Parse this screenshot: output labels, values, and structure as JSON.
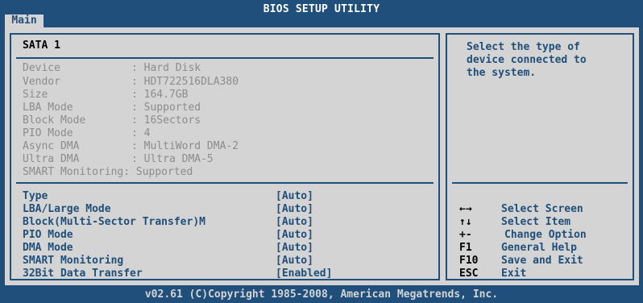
{
  "title": "BIOS SETUP UTILITY",
  "tabs": [
    {
      "label": "Main"
    }
  ],
  "section": {
    "title": "SATA 1"
  },
  "device_info": [
    {
      "label": "Device",
      "value": "Hard Disk"
    },
    {
      "label": "Vendor",
      "value": "HDT722516DLA380"
    },
    {
      "label": "Size",
      "value": "164.7GB"
    },
    {
      "label": "LBA Mode",
      "value": "Supported"
    },
    {
      "label": "Block Mode",
      "value": "16Sectors"
    },
    {
      "label": "PIO Mode",
      "value": "4"
    },
    {
      "label": "Async DMA",
      "value": "MultiWord DMA-2"
    },
    {
      "label": "Ultra DMA",
      "value": "Ultra DMA-5"
    }
  ],
  "smart_monitoring_info": "SMART Monitoring: Supported",
  "options": [
    {
      "label": "Type",
      "value": "[Auto]"
    },
    {
      "label": "LBA/Large Mode",
      "value": "[Auto]"
    },
    {
      "label": "Block(Multi-Sector Transfer)M",
      "value": "[Auto]"
    },
    {
      "label": "PIO Mode",
      "value": "[Auto]"
    },
    {
      "label": "DMA Mode",
      "value": "[Auto]"
    },
    {
      "label": "SMART Monitoring",
      "value": "[Auto]"
    },
    {
      "label": "32Bit Data Transfer",
      "value": "[Enabled]"
    }
  ],
  "help_text": [
    "Select the type of",
    "device connected to",
    "the system."
  ],
  "key_legend": [
    {
      "key": "←→",
      "desc": "Select Screen",
      "icon": "left-right-arrows-icon"
    },
    {
      "key": "↑↓",
      "desc": "Select Item",
      "icon": "up-down-arrows-icon"
    },
    {
      "key": "+-",
      "desc": "Change Option"
    },
    {
      "key": "F1",
      "desc": "General Help"
    },
    {
      "key": "F10",
      "desc": "Save and Exit"
    },
    {
      "key": "ESC",
      "desc": "Exit"
    }
  ],
  "footer": "v02.61 (C)Copyright 1985-2008, American Megatrends, Inc.",
  "colors": {
    "background": "#1f4f7a",
    "panel": "#d4d4d4",
    "highlight_text": "#1f4f7a",
    "disabled_text": "#8c8c8c"
  }
}
